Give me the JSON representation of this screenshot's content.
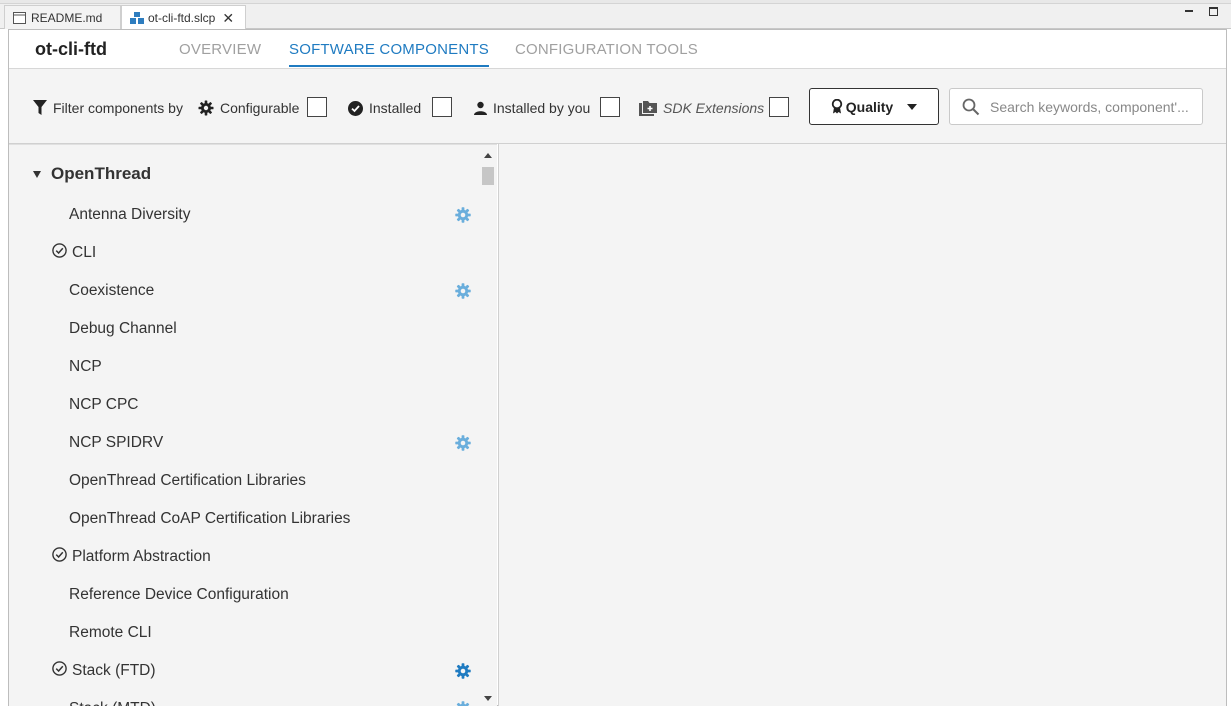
{
  "editor_tabs": [
    {
      "label": "README.md",
      "icon": "file-icon",
      "active": false
    },
    {
      "label": "ot-cli-ftd.slcp",
      "icon": "project-icon",
      "active": true
    }
  ],
  "close_glyph": "✕",
  "header": {
    "project_title": "ot-cli-ftd",
    "tabs": [
      "OVERVIEW",
      "SOFTWARE COMPONENTS",
      "CONFIGURATION TOOLS"
    ],
    "active_tab": "SOFTWARE COMPONENTS"
  },
  "filter_bar": {
    "label": "Filter components by",
    "configurable": "Configurable",
    "installed": "Installed",
    "installed_by_you": "Installed by you",
    "sdk_extensions": "SDK Extensions",
    "quality": "Quality",
    "search_placeholder": "Search keywords, component'..."
  },
  "tree": {
    "root": "OpenThread",
    "items": [
      {
        "label": "Antenna Diversity",
        "installed": false,
        "configurable": true
      },
      {
        "label": "CLI",
        "installed": true,
        "configurable": false
      },
      {
        "label": "Coexistence",
        "installed": false,
        "configurable": true
      },
      {
        "label": "Debug Channel",
        "installed": false,
        "configurable": false
      },
      {
        "label": "NCP",
        "installed": false,
        "configurable": false
      },
      {
        "label": "NCP CPC",
        "installed": false,
        "configurable": false
      },
      {
        "label": "NCP SPIDRV",
        "installed": false,
        "configurable": true
      },
      {
        "label": "OpenThread Certification Libraries",
        "installed": false,
        "configurable": false
      },
      {
        "label": "OpenThread CoAP Certification Libraries",
        "installed": false,
        "configurable": false
      },
      {
        "label": "Platform Abstraction",
        "installed": true,
        "configurable": false
      },
      {
        "label": "Reference Device Configuration",
        "installed": false,
        "configurable": false
      },
      {
        "label": "Remote CLI",
        "installed": false,
        "configurable": false
      },
      {
        "label": "Stack (FTD)",
        "installed": true,
        "configurable": true
      },
      {
        "label": "Stack (MTD)",
        "installed": false,
        "configurable": true
      }
    ]
  },
  "colors": {
    "accent": "#1f7bc1",
    "gear_light": "#6aaedc",
    "gear_dark": "#1f7bc1"
  }
}
